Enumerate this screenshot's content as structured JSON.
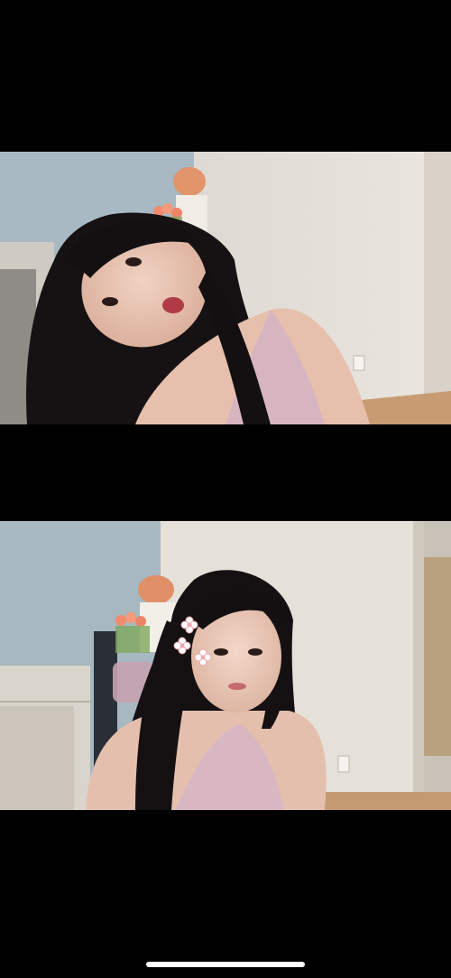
{
  "photos": [
    {
      "description_icon": "person-photo",
      "scene": "selfie-tilted-head"
    },
    {
      "description_icon": "person-photo",
      "scene": "selfie-with-flower-stickers"
    }
  ],
  "colors": {
    "background": "#000000",
    "wall_blue": "#a9b9c2",
    "wall_cream": "#e6e1d9",
    "hair": "#141012",
    "skin": "#e9c6b4",
    "top": "#d9b7c3",
    "floor": "#c99f76",
    "home_indicator": "#ffffff"
  }
}
